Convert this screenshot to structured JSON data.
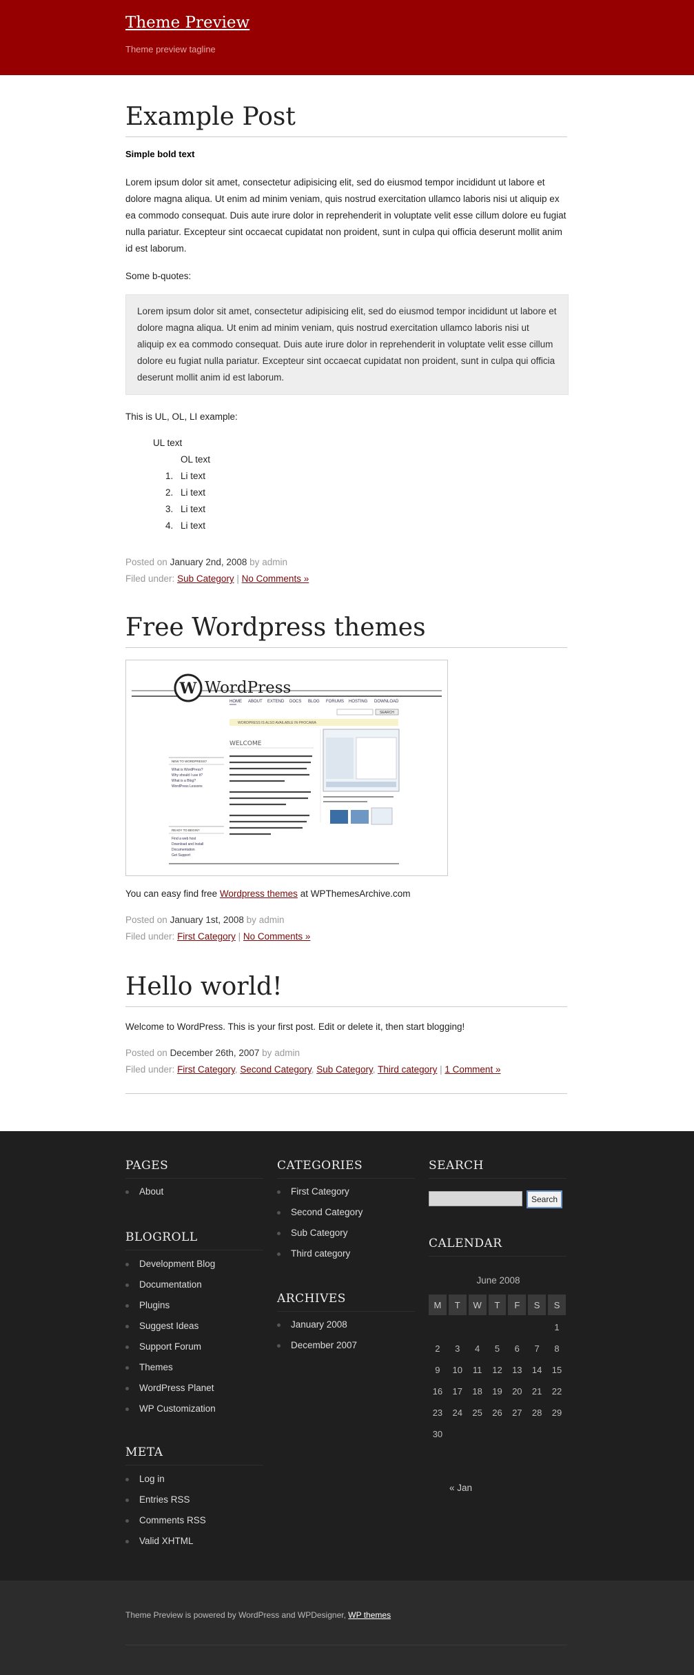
{
  "site": {
    "title": "Theme Preview",
    "tagline": "Theme preview tagline"
  },
  "posts": [
    {
      "title": "Example Post",
      "bold": "Simple bold text",
      "paragraph": "Lorem ipsum dolor sit amet, consectetur adipisicing elit, sed do eiusmod tempor incididunt ut labore et dolore magna aliqua. Ut enim ad minim veniam, quis nostrud exercitation ullamco laboris nisi ut aliquip ex ea commodo consequat. Duis aute irure dolor in reprehenderit in voluptate velit esse cillum dolore eu fugiat nulla pariatur. Excepteur sint occaecat cupidatat non proident, sunt in culpa qui officia deserunt mollit anim id est laborum.",
      "bquote_intro": "Some b-quotes:",
      "blockquote": "Lorem ipsum dolor sit amet, consectetur adipisicing elit, sed do eiusmod tempor incididunt ut labore et dolore magna aliqua. Ut enim ad minim veniam, quis nostrud exercitation ullamco laboris nisi ut aliquip ex ea commodo consequat. Duis aute irure dolor in reprehenderit in voluptate velit esse cillum dolore eu fugiat nulla pariatur. Excepteur sint occaecat cupidatat non proident, sunt in culpa qui officia deserunt mollit anim id est laborum.",
      "list_intro": "This is UL, OL, LI example:",
      "ul_text": "UL text",
      "ol_text": "OL text",
      "list_items": [
        {
          "num": "1.",
          "text": "Li text"
        },
        {
          "num": "2.",
          "text": "Li text"
        },
        {
          "num": "3.",
          "text": "Li text"
        },
        {
          "num": "4.",
          "text": "Li text"
        }
      ],
      "posted_on": "Posted on",
      "date": "January 2nd, 2008",
      "by": "by",
      "author": "admin",
      "filed_under": "Filed under:",
      "categories": [
        "Sub Category"
      ],
      "comments": "No Comments »"
    },
    {
      "title": "Free Wordpress themes",
      "text_before": "You can easy find free",
      "link": "Wordpress themes",
      "text_after": "at WPThemesArchive.com",
      "posted_on": "Posted on",
      "date": "January 1st, 2008",
      "by": "by",
      "author": "admin",
      "filed_under": "Filed under:",
      "categories": [
        "First Category"
      ],
      "comments": "No Comments »",
      "screenshot": {
        "logo": "WordPress",
        "nav": [
          "HOME",
          "ABOUT",
          "EXTEND",
          "DOCS",
          "BLOG",
          "FORUMS",
          "HOSTING",
          "DOWNLOAD"
        ],
        "search_label": "SEARCH",
        "banner": "WORDPRESS IS ALSO AVAILABLE IN PHOCAWA",
        "welcome": "WELCOME",
        "sidebar1_title": "NEW TO WORDPRESS?",
        "sidebar1_items": [
          "What is WordPress?",
          "Why should I use it?",
          "What is a Blog?",
          "WordPress Lessons"
        ],
        "sidebar2_title": "READY TO BEGIN?",
        "sidebar2_items": [
          "Find a web host",
          "Download and Install",
          "Documentation",
          "Get Support"
        ]
      }
    },
    {
      "title": "Hello world!",
      "text": "Welcome to WordPress. This is your first post. Edit or delete it, then start blogging!",
      "posted_on": "Posted on",
      "date": "December 26th, 2007",
      "by": "by",
      "author": "admin",
      "filed_under": "Filed under:",
      "categories": [
        "First Category",
        "Second Category",
        "Sub Category",
        "Third category"
      ],
      "comments": "1 Comment »"
    }
  ],
  "widgets": {
    "pages": {
      "title": "PAGES",
      "items": [
        "About"
      ]
    },
    "blogroll": {
      "title": "BLOGROLL",
      "items": [
        "Development Blog",
        "Documentation",
        "Plugins",
        "Suggest Ideas",
        "Support Forum",
        "Themes",
        "WordPress Planet",
        "WP Customization"
      ]
    },
    "meta": {
      "title": "META",
      "items": [
        "Log in",
        "Entries RSS",
        "Comments RSS",
        "Valid XHTML"
      ]
    },
    "categories": {
      "title": "CATEGORIES",
      "items": [
        "First Category",
        "Second Category",
        "Sub Category",
        "Third category"
      ]
    },
    "archives": {
      "title": "ARCHIVES",
      "items": [
        "January 2008",
        "December 2007"
      ]
    },
    "search": {
      "title": "SEARCH",
      "button": "Search",
      "value": ""
    },
    "calendar": {
      "title": "CALENDAR",
      "caption": "June 2008",
      "weekdays": [
        "M",
        "T",
        "W",
        "T",
        "F",
        "S",
        "S"
      ],
      "rows": [
        [
          "",
          "",
          "",
          "",
          "",
          "",
          "1"
        ],
        [
          "2",
          "3",
          "4",
          "5",
          "6",
          "7",
          "8"
        ],
        [
          "9",
          "10",
          "11",
          "12",
          "13",
          "14",
          "15"
        ],
        [
          "16",
          "17",
          "18",
          "19",
          "20",
          "21",
          "22"
        ],
        [
          "23",
          "24",
          "25",
          "26",
          "27",
          "28",
          "29"
        ],
        [
          "30",
          "",
          "",
          "",
          "",
          "",
          ""
        ]
      ],
      "prev": "« Jan"
    }
  },
  "footer": {
    "text": "Theme Preview is powered by WordPress and WPDesigner,",
    "link": "WP themes"
  },
  "colors": {
    "header_bg": "#960000",
    "link": "#7a0a0a",
    "widgets_bg": "#1f1f1f",
    "footer_bg": "#2c2c2c"
  }
}
